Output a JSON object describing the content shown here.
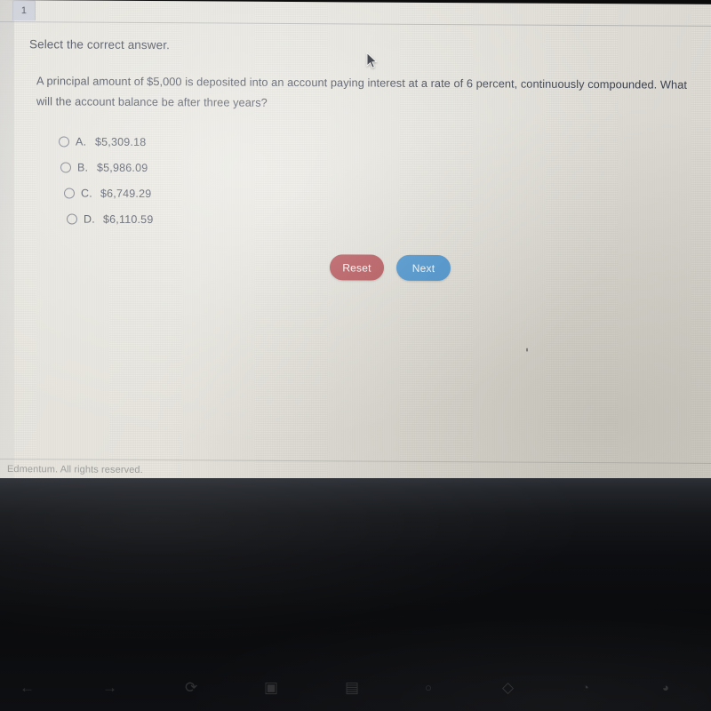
{
  "window": {
    "tab_label": "1"
  },
  "content": {
    "prompt": "Select the correct answer.",
    "question": "A principal amount of $5,000 is deposited into an account paying interest at a rate of 6 percent, continuously compounded. What will the account balance be after three years?",
    "options": [
      {
        "letter": "A.",
        "value": "$5,309.18",
        "selected": false
      },
      {
        "letter": "B.",
        "value": "$5,986.09",
        "selected": false
      },
      {
        "letter": "C.",
        "value": "$6,749.29",
        "selected": false
      },
      {
        "letter": "D.",
        "value": "$6,110.59",
        "selected": false
      }
    ]
  },
  "actions": {
    "reset_label": "Reset",
    "next_label": "Next"
  },
  "footer": {
    "copyright": "Edmentum. All rights reserved."
  },
  "colors": {
    "screen_background": "#e9e7e0",
    "text": "#3b4150",
    "reset_button": "#b3484e",
    "next_button": "#3c8ed1",
    "tab": "#c9ccd6",
    "footer_text": "#9b9b98",
    "bezel": "#0d0e11"
  },
  "function_keys": [
    {
      "icon": "back-arrow-icon",
      "glyph": "←"
    },
    {
      "icon": "forward-arrow-icon",
      "glyph": "→"
    },
    {
      "icon": "reload-icon",
      "glyph": "⟳"
    },
    {
      "icon": "fullscreen-icon",
      "glyph": "▣"
    },
    {
      "icon": "window-overview-icon",
      "glyph": "▤"
    },
    {
      "icon": "brightness-down-icon",
      "glyph": "○"
    },
    {
      "icon": "brightness-up-icon",
      "glyph": "◇"
    },
    {
      "icon": "mute-icon",
      "glyph": "◔"
    },
    {
      "icon": "volume-icon",
      "glyph": "◕"
    }
  ]
}
